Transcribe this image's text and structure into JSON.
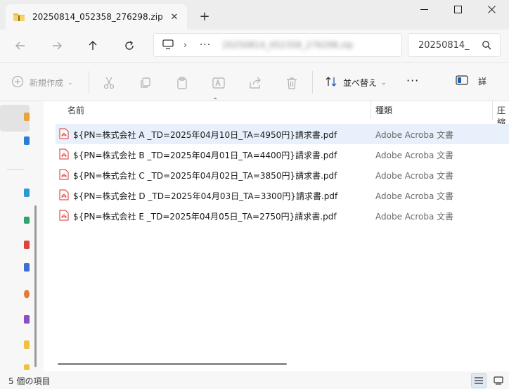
{
  "window": {
    "tab_title": "20250814_052358_276298.zip",
    "tab_close_symbol": "✕",
    "new_tab_symbol": "+"
  },
  "address_bar": {
    "separator": "›",
    "overflow": "···",
    "blurred_path": "20250814_052358_276298.zip"
  },
  "search": {
    "value": "20250814_"
  },
  "toolbar": {
    "new_label": "新規作成",
    "sort_label": "並べ替え",
    "more_label": "···",
    "details_label": "詳"
  },
  "columns": {
    "name": "名前",
    "type": "種類",
    "compressed": "圧縮"
  },
  "files": [
    {
      "name": "${PN=株式会社 A _TD=2025年04月10日_TA=4950円}請求書.pdf",
      "type": "Adobe Acroba 文書",
      "selected": true
    },
    {
      "name": "${PN=株式会社 B _TD=2025年04月01日_TA=4400円}請求書.pdf",
      "type": "Adobe Acroba 文書",
      "selected": false
    },
    {
      "name": "${PN=株式会社 C _TD=2025年04月02日_TA=3850円}請求書.pdf",
      "type": "Adobe Acroba 文書",
      "selected": false
    },
    {
      "name": "${PN=株式会社 D _TD=2025年04月03日_TA=3300円}請求書.pdf",
      "type": "Adobe Acroba 文書",
      "selected": false
    },
    {
      "name": "${PN=株式会社 E _TD=2025年04月05日_TA=2750円}請求書.pdf",
      "type": "Adobe Acroba 文書",
      "selected": false
    }
  ],
  "status": {
    "item_count": "5 個の項目"
  },
  "colors": {
    "accent_folder": "#f0c040",
    "pdf_red": "#d9302c",
    "selection": "#e8f1fb"
  }
}
